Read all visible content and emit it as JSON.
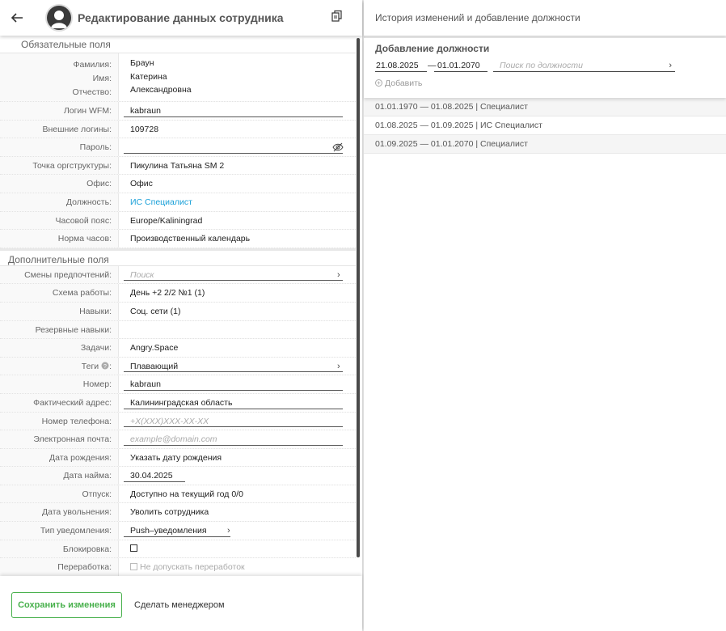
{
  "header": {
    "title": "Редактирование данных сотрудника"
  },
  "required": {
    "title": "Обязательные поля",
    "fio_labels": [
      "Фамилия:",
      "Имя:",
      "Отчество:"
    ],
    "fio_values": [
      "Браун",
      "Катерина",
      "Александровна"
    ],
    "rows": [
      {
        "label": "Логин WFM:",
        "value": "kabraun"
      },
      {
        "label": "Внешние логины:",
        "value": "109728"
      },
      {
        "label": "Пароль:",
        "value": ""
      },
      {
        "label": "Точка оргструктуры:",
        "value": "Пикулина Татьяна SM 2"
      },
      {
        "label": "Офис:",
        "value": "Офис"
      },
      {
        "label": "Должность:",
        "value": "ИС Специалист"
      },
      {
        "label": "Часовой пояс:",
        "value": "Europe/Kaliningrad"
      },
      {
        "label": "Норма часов:",
        "value": "Производственный календарь"
      }
    ]
  },
  "additional": {
    "title": "Дополнительные поля",
    "rows": [
      {
        "label": "Смены предпочтений:",
        "placeholder": "Поиск"
      },
      {
        "label": "Схема работы:",
        "value": "День +2 2/2 №1 (1)"
      },
      {
        "label": "Навыки:",
        "value": "Соц. сети (1)"
      },
      {
        "label": "Резервные навыки:",
        "value": ""
      },
      {
        "label": "Задачи:",
        "value": "Angry.Space"
      },
      {
        "label": "Теги",
        "label_suffix": ":",
        "value": "Плавающий"
      },
      {
        "label": "Номер:",
        "value": "kabraun"
      },
      {
        "label": "Фактический адрес:",
        "value": "Калининградская область"
      },
      {
        "label": "Номер телефона:",
        "placeholder": "+X(XXX)XXX-XX-XX"
      },
      {
        "label": "Электронная почта:",
        "placeholder": "example@domain.com"
      },
      {
        "label": "Дата рождения:",
        "value": "Указать дату рождения"
      },
      {
        "label": "Дата найма:",
        "value": "30.04.2025"
      },
      {
        "label": "Отпуск:",
        "value": "Доступно на текущий год 0/0"
      },
      {
        "label": "Дата увольнения:",
        "value": "Уволить сотрудника"
      },
      {
        "label": "Тип уведомления:",
        "value": "Push–уведомления"
      },
      {
        "label": "Блокировка:",
        "value": ""
      },
      {
        "label": "Переработка:",
        "value": "Не допускать переработок"
      }
    ]
  },
  "footer": {
    "save_label": "Сохранить изменения",
    "manager_label": "Сделать менеджером"
  },
  "right": {
    "title": "История изменений и добавление должности",
    "add_title": "Добавление должности",
    "date_from": "21.08.2025",
    "date_dash": "—",
    "date_to": "01.01.2070",
    "search_placeholder": "Поиск по должности",
    "add_label": "Добавить",
    "history": [
      "01.01.1970 — 01.08.2025 | Специалист",
      "01.08.2025 — 01.09.2025 | ИС Специалист",
      "01.09.2025 — 01.01.2070 | Специалист"
    ]
  },
  "colors": {
    "accent_green": "#47b04b",
    "link_blue": "#1aa0d8"
  }
}
